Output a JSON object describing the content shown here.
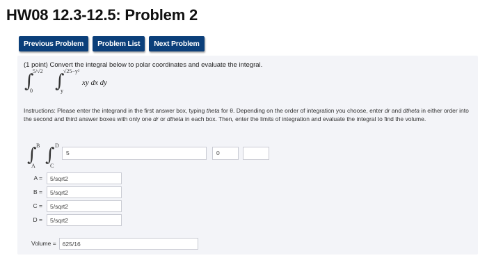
{
  "page": {
    "title": "HW08 12.3-12.5: Problem 2"
  },
  "nav": {
    "previous": "Previous Problem",
    "list": "Problem List",
    "next": "Next Problem"
  },
  "problem": {
    "intro": "(1 point) Convert the integral below to polar coordinates and evaluate the integral.",
    "integral": {
      "outer_upper": "5/√2",
      "outer_lower": "0",
      "inner_upper": "√25−y²",
      "inner_lower": "y",
      "integrand": "xy dx dy"
    },
    "instructions": [
      "Instructions: Please enter the integrand in the first answer box, typing ",
      "theta",
      " for θ. Depending on the order of integration you choose, enter ",
      "dr",
      " and ",
      "dtheta",
      " in either order into the second and third answer boxes with only one ",
      "dr",
      " or ",
      "dtheta",
      " in each box. Then, enter the limits of integration and evaluate the integral to find the volume."
    ],
    "answer": {
      "limit_B": "B",
      "limit_A": "A",
      "limit_D": "D",
      "limit_C": "C",
      "integrand_value": "5",
      "diff1_value": "0",
      "diff2_value": ""
    },
    "limits": [
      {
        "label": "A =",
        "value": "5/sqrt2"
      },
      {
        "label": "B =",
        "value": "5/sqrt2"
      },
      {
        "label": "C =",
        "value": "5/sqrt2"
      },
      {
        "label": "D =",
        "value": "5/sqrt2"
      }
    ],
    "volume": {
      "label": "Volume =",
      "value": "625/16"
    }
  }
}
